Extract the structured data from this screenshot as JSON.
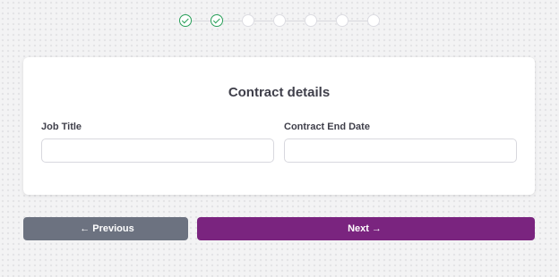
{
  "stepper": {
    "steps": [
      {
        "state": "complete"
      },
      {
        "state": "complete"
      },
      {
        "state": "pending"
      },
      {
        "state": "pending"
      },
      {
        "state": "pending"
      },
      {
        "state": "pending"
      },
      {
        "state": "pending"
      }
    ],
    "complete_color": "#2aa05a"
  },
  "form": {
    "title": "Contract details",
    "job_title": {
      "label": "Job Title",
      "value": "",
      "placeholder": ""
    },
    "contract_end_date": {
      "label": "Contract End Date",
      "value": "",
      "placeholder": ""
    }
  },
  "nav": {
    "previous_label": "Previous",
    "previous_arrow": "←",
    "next_label": "Next",
    "next_arrow": "→"
  },
  "colors": {
    "accent": "#7a247f",
    "secondary_button": "#6c7280",
    "success": "#2aa05a"
  }
}
